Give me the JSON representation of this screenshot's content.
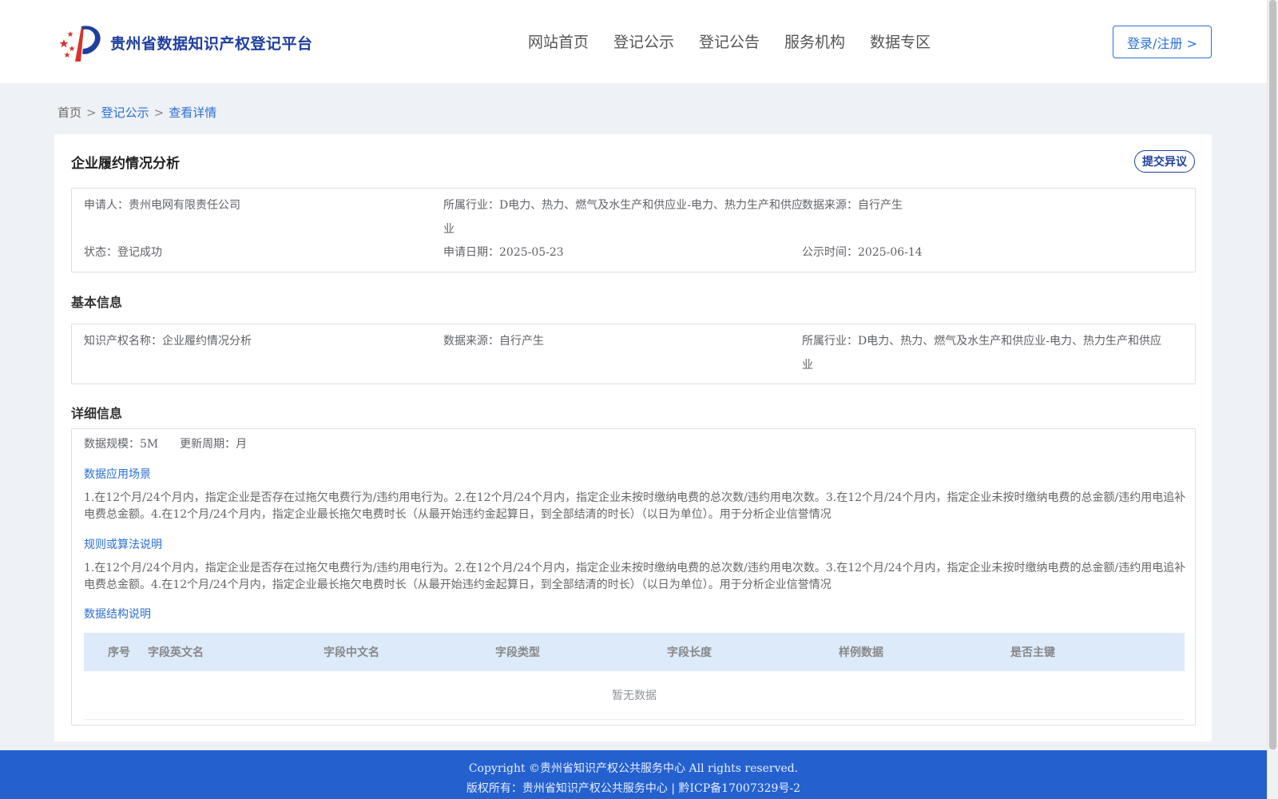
{
  "header": {
    "logo_text": "贵州省数据知识产权登记平台",
    "nav": [
      "网站首页",
      "登记公示",
      "登记公告",
      "服务机构",
      "数据专区"
    ],
    "login_label": "登录/注册 >"
  },
  "breadcrumb": {
    "home": "首页",
    "sep": ">",
    "level1": "登记公示",
    "current": "查看详情"
  },
  "detail": {
    "title": "企业履约情况分析",
    "objection_button": "提交异议",
    "summary": {
      "applicant_label": "申请人：",
      "applicant": "贵州电网有限责任公司",
      "industry_label": "所属行业：",
      "industry_line1": "D电力、热力、燃气及水生产和供应业-电力、热力生产和供应",
      "industry_line2": "业",
      "source_label": "数据来源：",
      "source": "自行产生",
      "status_label": "状态：",
      "status": "登记成功",
      "apply_date_label": "申请日期：",
      "apply_date": "2025-05-23",
      "publish_time_label": "公示时间：",
      "publish_time": "2025-06-14"
    },
    "basic": {
      "section_title": "基本信息",
      "ip_name_label": "知识产权名称：",
      "ip_name": "企业履约情况分析",
      "source_label": "数据来源：",
      "source": "自行产生",
      "industry_label": "所属行业：",
      "industry_line1": "D电力、热力、燃气及水生产和供应业-电力、热力生产和供应",
      "industry_line2": "业"
    },
    "detailed": {
      "section_title": "详细信息",
      "scale_label": "数据规模：",
      "scale": "5M",
      "cycle_label": "更新周期：",
      "cycle": "月",
      "scenario_title": "数据应用场景",
      "scenario_text": "1.在12个月/24个月内，指定企业是否存在过拖欠电费行为/违约用电行为。2.在12个月/24个月内，指定企业未按时缴纳电费的总次数/违约用电次数。3.在12个月/24个月内，指定企业未按时缴纳电费的总金额/违约用电追补电费总金额。4.在12个月/24个月内，指定企业最长拖欠电费时长（从最开始违约金起算日，到全部结清的时长）（以日为单位）。用于分析企业信誉情况",
      "rule_title": "规则或算法说明",
      "rule_text": "1.在12个月/24个月内，指定企业是否存在过拖欠电费行为/违约用电行为。2.在12个月/24个月内，指定企业未按时缴纳电费的总次数/违约用电次数。3.在12个月/24个月内，指定企业未按时缴纳电费的总金额/违约用电追补电费总金额。4.在12个月/24个月内，指定企业最长拖欠电费时长（从最开始违约金起算日，到全部结清的时长）（以日为单位）。用于分析企业信誉情况",
      "structure_title": "数据结构说明",
      "table_headers": [
        "序号",
        "字段英文名",
        "字段中文名",
        "字段类型",
        "字段长度",
        "样例数据",
        "是否主键"
      ],
      "empty_text": "暂无数据"
    }
  },
  "footer": {
    "copyright": "Copyright ©贵州省知识产权公共服务中心 All rights reserved.",
    "owner": "版权所有：贵州省知识产权公共服务中心 | 黔ICP备17007329号-2"
  },
  "colors": {
    "brand": "#1e3f9e",
    "accent": "#2b6fd6",
    "footer": "#2461cf",
    "table_header": "#ddeaf9"
  }
}
